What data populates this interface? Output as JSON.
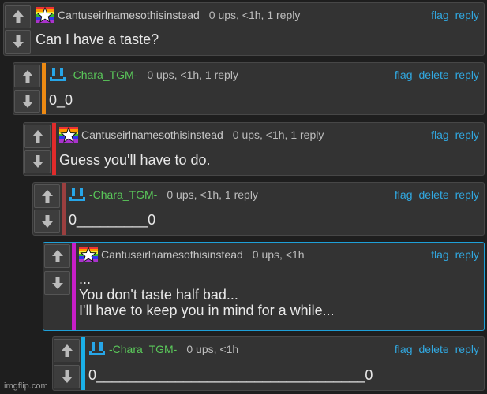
{
  "comments": [
    {
      "username": "Cantuseirlnamesothisinstead",
      "meta": "0 ups, <1h, 1 reply",
      "actions": [
        "flag",
        "reply"
      ],
      "text": "Can I have a taste?",
      "bar_color": "",
      "avatar": "rainbow-star-icon"
    },
    {
      "username": "-Chara_TGM-",
      "meta": "0 ups, <1h, 1 reply",
      "actions": [
        "flag",
        "delete",
        "reply"
      ],
      "text": "0_0",
      "bar_color": "#ee8a13",
      "avatar": "blue-smiley-icon"
    },
    {
      "username": "Cantuseirlnamesothisinstead",
      "meta": "0 ups, <1h, 1 reply",
      "actions": [
        "flag",
        "reply"
      ],
      "text": "Guess you'll have to do.",
      "bar_color": "#e02b2b",
      "avatar": "rainbow-star-icon"
    },
    {
      "username": "-Chara_TGM-",
      "meta": "0 ups, <1h, 1 reply",
      "actions": [
        "flag",
        "delete",
        "reply"
      ],
      "text": "0_________0",
      "bar_color": "#9b3f3f",
      "avatar": "blue-smiley-icon"
    },
    {
      "username": "Cantuseirlnamesothisinstead",
      "meta": "0 ups, <1h",
      "actions": [
        "flag",
        "reply"
      ],
      "text": "...\nYou don't taste half bad...\nI'll have to keep you in mind for a while...",
      "bar_color": "#c81ec8",
      "avatar": "rainbow-star-icon"
    },
    {
      "username": "-Chara_TGM-",
      "meta": "0 ups, <1h",
      "actions": [
        "flag",
        "delete",
        "reply"
      ],
      "text": "0__________________________________0",
      "bar_color": "#1ab0e8",
      "avatar": "blue-smiley-icon"
    }
  ],
  "watermark": "imgflip.com",
  "colors": {
    "link": "#31a8e0",
    "chara_name": "#5ac85a",
    "active_border": "#1ea0d8"
  }
}
